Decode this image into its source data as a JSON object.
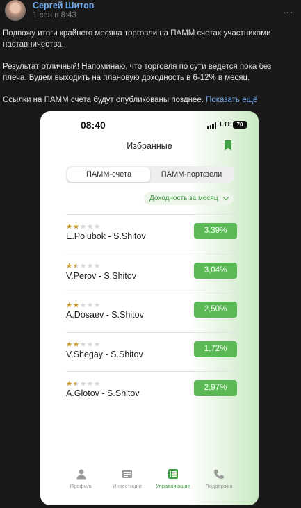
{
  "post": {
    "author": "Сергей Шитов",
    "time": "1 сен в 8:43",
    "more_icon": "…",
    "paragraphs": [
      "Подвожу итоги крайнего месяца торговли на ПАММ счетах участниками наставничества.",
      "Результат отличный! Напоминаю, что торговля по сути ведется пока без плеча. Будем выходить на плановую доходность в 6-12% в месяц.",
      "Ссылки на ПАММ счета будут опубликованы позднее."
    ],
    "show_more": "Показать ещё"
  },
  "phone": {
    "clock": "08:40",
    "network": "LTE",
    "battery": "70",
    "title": "Избранные",
    "segments": [
      "ПАММ-счета",
      "ПАММ-портфели"
    ],
    "filter": "Доходность за месяц",
    "accent": "#43a047",
    "rows": [
      {
        "rating": 2,
        "name": "E.Polubok - S.Shitov",
        "pct": "3,39%"
      },
      {
        "rating": 1.5,
        "name": "V.Perov - S.Shitov",
        "pct": "3,04%"
      },
      {
        "rating": 2,
        "name": "A.Dosaev - S.Shitov",
        "pct": "2,50%"
      },
      {
        "rating": 2,
        "name": "V.Shegay - S.Shitov",
        "pct": "1,72%"
      },
      {
        "rating": 1.5,
        "name": "A.Glotov - S.Shitov",
        "pct": "2,97%"
      }
    ],
    "tabs": [
      {
        "label": "Профиль",
        "icon": "profile-icon"
      },
      {
        "label": "Инвестиции",
        "icon": "investments-icon"
      },
      {
        "label": "Управляющие",
        "icon": "managers-icon",
        "active": true
      },
      {
        "label": "Поддержка",
        "icon": "phone-icon"
      }
    ]
  }
}
